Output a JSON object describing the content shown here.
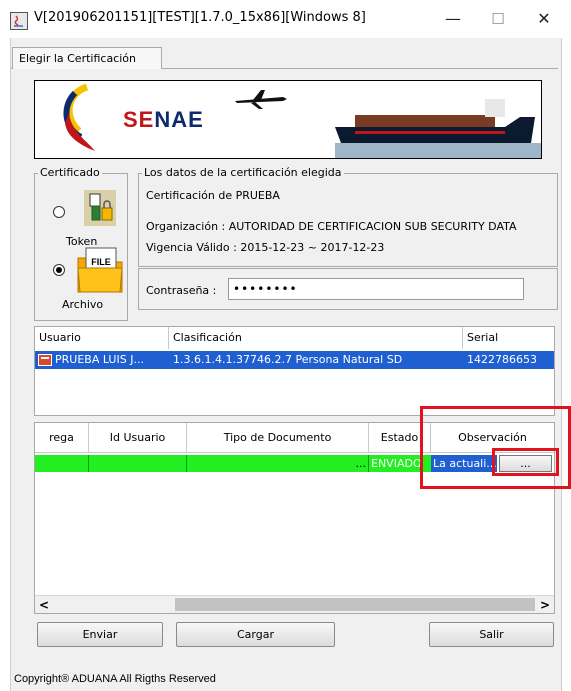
{
  "window": {
    "title": "V[201906201151][TEST][1.7.0_15x86][Windows 8]",
    "minimize_glyph": "—",
    "maximize_glyph": "☐",
    "close_glyph": "✕"
  },
  "tab": {
    "label": "Elegir la Certificación"
  },
  "banner": {
    "brand_part1": "SE",
    "brand_part2": "NAE"
  },
  "certificado": {
    "legend": "Certificado",
    "token_label": "Token",
    "archivo_label": "Archivo",
    "file_icon_text": "FILE",
    "selected": "archivo"
  },
  "datos": {
    "legend": "Los datos de la certificación elegida",
    "cert_name": "Certificación de PRUEBA",
    "organizacion": "Organización : AUTORIDAD DE CERTIFICACION SUB SECURITY DATA",
    "vigencia": "Vigencia Válido : 2015-12-23 ~ 2017-12-23",
    "password_label": "Contraseña :",
    "password_value": "••••••••"
  },
  "cert_table": {
    "headers": [
      "Usuario",
      "Clasificación",
      "Serial"
    ],
    "rows": [
      {
        "usuario": "PRUEBA LUIS J...",
        "clasificacion": "1.3.6.1.4.1.37746.2.7 Persona Natural SD",
        "serial": "1422786653"
      }
    ]
  },
  "docs_table": {
    "headers": [
      "rega",
      "Id Usuario",
      "Tipo de Documento",
      "Estado",
      "Observación"
    ],
    "rows": [
      {
        "entrega": "",
        "id_usuario": "",
        "tipo_documento": "...",
        "estado": "ENVIADO",
        "observacion": "La actuali...",
        "detail_button": "..."
      }
    ]
  },
  "scrollbar": {
    "left_arrow": "<",
    "right_arrow": ">"
  },
  "buttons": {
    "enviar": "Enviar",
    "cargar": "Cargar",
    "salir": "Salir"
  },
  "footer": {
    "copyright": "Copyright® ADUANA All Rigths Reserved"
  },
  "colors": {
    "selection_row": "#1f5fd1",
    "status_green": "#22ee22",
    "highlight_red": "#e0141c",
    "brand_red": "#c0151b",
    "brand_navy": "#0d2a6b"
  }
}
